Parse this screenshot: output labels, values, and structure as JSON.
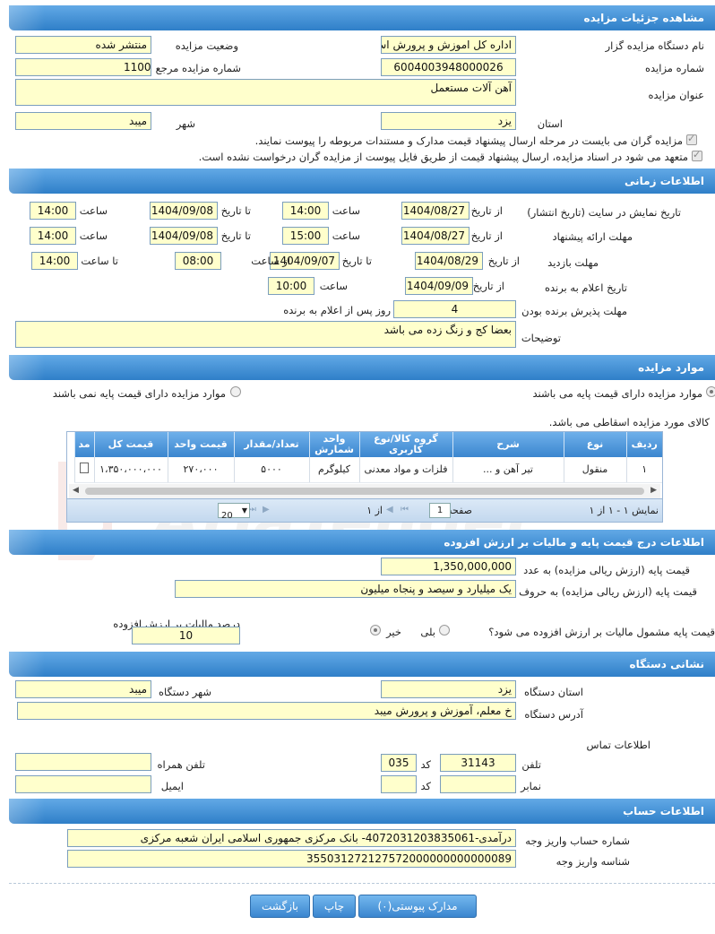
{
  "details": {
    "header": "مشاهده جزئیات مزایده",
    "org_label": "نام دستگاه مزایده گزار",
    "org_value": "اداره کل اموزش و پرورش اس",
    "status_label": "وضعیت مزایده",
    "status_value": "منتشر شده",
    "number_label": "شماره مزایده",
    "number_value": "6004003948000026",
    "ref_label": "شماره مزایده مرجع",
    "ref_value": "1100",
    "title_label": "عنوان مزایده",
    "title_value": "آهن آلات مستعمل",
    "province_label": "استان",
    "province_value": "یزد",
    "city_label": "شهر",
    "city_value": "میبد",
    "check1": "مزایده گران می بایست در مرحله ارسال پیشنهاد قیمت مدارک و مستندات مربوطه را پیوست نمایند.",
    "check2": "متعهد می شود در اسناد مزایده، ارسال پیشنهاد قیمت از طریق فایل پیوست از مزایده گران درخواست نشده است."
  },
  "time": {
    "header": "اطلاعات زمانی",
    "row1_label": "تاریخ نمایش در سایت (تاریخ انتشار)",
    "row1_from_label": "از تاریخ",
    "row1_from": "1404/08/27",
    "row1_time_label": "ساعت",
    "row1_time": "14:00",
    "row1_to_label": "تا تاریخ",
    "row1_to": "1404/09/08",
    "row1_time2_label": "ساعت",
    "row1_time2": "14:00",
    "row2_label": "مهلت ارائه پیشنهاد",
    "row2_from_label": "از تاریخ",
    "row2_from": "1404/08/27",
    "row2_time_label": "ساعت",
    "row2_time": "15:00",
    "row2_to_label": "تا تاریخ",
    "row2_to": "1404/09/08",
    "row2_time2_label": "ساعت",
    "row2_time2": "14:00",
    "row3_label": "مهلت بازدید",
    "row3_from_label": "از تاریخ",
    "row3_from": "1404/08/29",
    "row3_to_label": "تا تاریخ",
    "row3_to": "1404/09/07",
    "row3_fromtime_label": "از ساعت",
    "row3_fromtime": "08:00",
    "row3_totime_label": "تا ساعت",
    "row3_totime": "14:00",
    "row4_label": "تاریخ اعلام به برنده",
    "row4_from_label": "از تاریخ",
    "row4_from": "1404/09/09",
    "row4_time_label": "ساعت",
    "row4_time": "10:00",
    "row5_label": "مهلت پذیرش برنده بودن",
    "row5_value": "4",
    "row5_suffix": "روز پس از اعلام به برنده",
    "notes_label": "توضیحات",
    "notes_value": "بعضا کج و زنگ زده می باشد"
  },
  "items": {
    "header": "موارد مزایده",
    "radio_yes": "موارد مزایده دارای قیمت پایه می باشند",
    "radio_no": "موارد مزایده دارای قیمت پایه نمی باشند",
    "desc": "کالای مورد مزایده اسقاطی می باشد.",
    "columns": [
      "ردیف",
      "نوع",
      "شرح",
      "گروه کالا/نوع کاربری",
      "واحد شمارش",
      "تعداد/مقدار",
      "قیمت واحد",
      "قیمت کل",
      "مد"
    ],
    "rows": [
      [
        "۱",
        "منقول",
        "تیر آهن و ...",
        "فلزات و مواد معدنی",
        "کیلوگرم",
        "۵۰۰۰",
        "۲۷۰،۰۰۰",
        "۱،۳۵۰،۰۰۰،۰۰۰",
        ""
      ]
    ],
    "pager_info": "نمایش ۱ - ۱ از ۱",
    "pager_page_label": "صفحه",
    "pager_page": "1",
    "pager_of": "از ۱",
    "pager_size": "20"
  },
  "price": {
    "header": "اطلاعات درج قیمت پایه و مالیات بر ارزش افزوده",
    "num_label": "قیمت پایه (ارزش ریالی مزایده) به عدد",
    "num_value": "1,350,000,000",
    "words_label": "قیمت پایه (ارزش ریالی مزایده) به حروف",
    "words_value": "یک میلیارد و سیصد و پنجاه میلیون",
    "vat_question": "قیمت پایه مشمول مالیات بر ارزش افزوده می شود؟",
    "yes": "بلی",
    "no": "خیر",
    "vat_pct_label": "درصد مالیات بر ارزش افزوده",
    "vat_pct_value": "10"
  },
  "address": {
    "header": "نشانی دستگاه",
    "province_label": "استان دستگاه",
    "province_value": "یزد",
    "city_label": "شهر دستگاه",
    "city_value": "میبد",
    "addr_label": "آدرس دستگاه",
    "addr_value": "خ معلم، آموزش و پرورش میبد",
    "contact_label": "اطلاعات تماس",
    "phone_label": "تلفن",
    "phone_value": "31143",
    "code_label": "کد",
    "code_value": "035",
    "mobile_label": "تلفن همراه",
    "mobile_value": "",
    "fax_label": "نمابر",
    "fax_value": "",
    "fax_code_label": "کد",
    "fax_code_value": "",
    "email_label": "ایمیل",
    "email_value": ""
  },
  "account": {
    "header": "اطلاعات حساب",
    "acc_label": "شماره حساب واریز وجه",
    "acc_value": "درآمدی-4072031203835061- بانک مرکزی جمهوری اسلامی ایران شعبه مرکزی",
    "id_label": "شناسه واریز وجه",
    "id_value": "355031272127572000000000000089"
  },
  "buttons": {
    "docs": "مدارک پیوستی(۰)",
    "print": "چاپ",
    "back": "بازگشت"
  }
}
